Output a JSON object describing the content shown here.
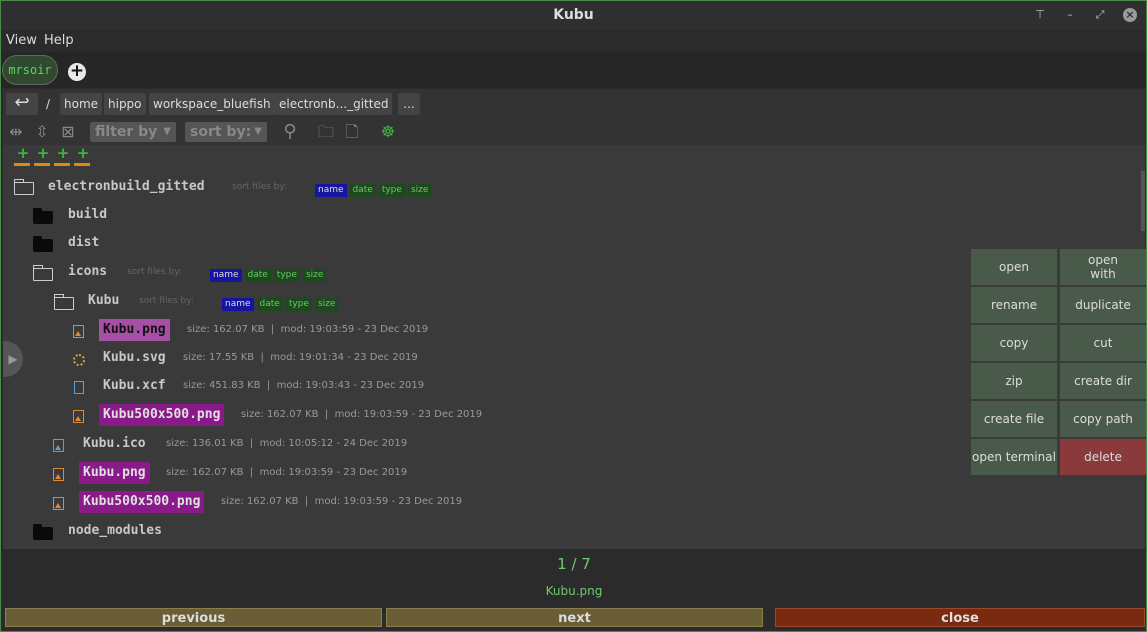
{
  "window": {
    "title": "Kubu"
  },
  "menu": {
    "view": "View",
    "help": "Help"
  },
  "tabs": [
    {
      "label": "mrsoir"
    }
  ],
  "breadcrumb": {
    "root": "/",
    "items": [
      "home",
      "hippo",
      "workspace_bluefish",
      "electronb..._gitted"
    ],
    "more": "..."
  },
  "toolbar": {
    "filter_label": "filter by",
    "sort_label": "sort by:"
  },
  "sort_options": {
    "label": "sort files by:",
    "name": "name",
    "date": "date",
    "type": "type",
    "size": "size"
  },
  "tree": {
    "root": "electronbuild_gitted",
    "build": "build",
    "dist": "dist",
    "icons": "icons",
    "kubu_dir": "Kubu",
    "files_in_kubu": [
      {
        "name": "Kubu.png",
        "size": "size: 162.07 KB",
        "mod": "mod: 19:03:59 - 23 Dec 2019"
      },
      {
        "name": "Kubu.svg",
        "size": "size: 17.55 KB",
        "mod": "mod: 19:01:34 - 23 Dec 2019"
      },
      {
        "name": "Kubu.xcf",
        "size": "size: 451.83 KB",
        "mod": "mod: 19:03:43 - 23 Dec 2019"
      },
      {
        "name": "Kubu500x500.png",
        "size": "size: 162.07 KB",
        "mod": "mod: 19:03:59 - 23 Dec 2019"
      }
    ],
    "files_in_icons": [
      {
        "name": "Kubu.ico",
        "size": "size: 136.01 KB",
        "mod": "mod: 10:05:12 - 24 Dec 2019"
      },
      {
        "name": "Kubu.png",
        "size": "size: 162.07 KB",
        "mod": "mod: 19:03:59 - 23 Dec 2019"
      },
      {
        "name": "Kubu500x500.png",
        "size": "size: 162.07 KB",
        "mod": "mod: 19:03:59 - 23 Dec 2019"
      }
    ],
    "node_modules": "node_modules"
  },
  "actions": {
    "open": "open",
    "open_with_1": "open",
    "open_with_2": "with",
    "rename": "rename",
    "duplicate": "duplicate",
    "copy": "copy",
    "cut": "cut",
    "zip": "zip",
    "create_dir": "create dir",
    "create_file": "create file",
    "copy_path": "copy path",
    "open_terminal": "open terminal",
    "delete": "delete"
  },
  "viewer": {
    "counter": "1 / 7",
    "filename": "Kubu.png"
  },
  "nav": {
    "previous": "previous",
    "next": "next",
    "close": "close"
  },
  "colors": {
    "highlight_selected": "#a550a5",
    "highlight_marked": "#8a1a8a",
    "accent_green": "#6fc96f",
    "delete_red": "#8a3a3a",
    "prev_next_bg": "#6a5e36",
    "close_bg": "#7a2a10"
  }
}
